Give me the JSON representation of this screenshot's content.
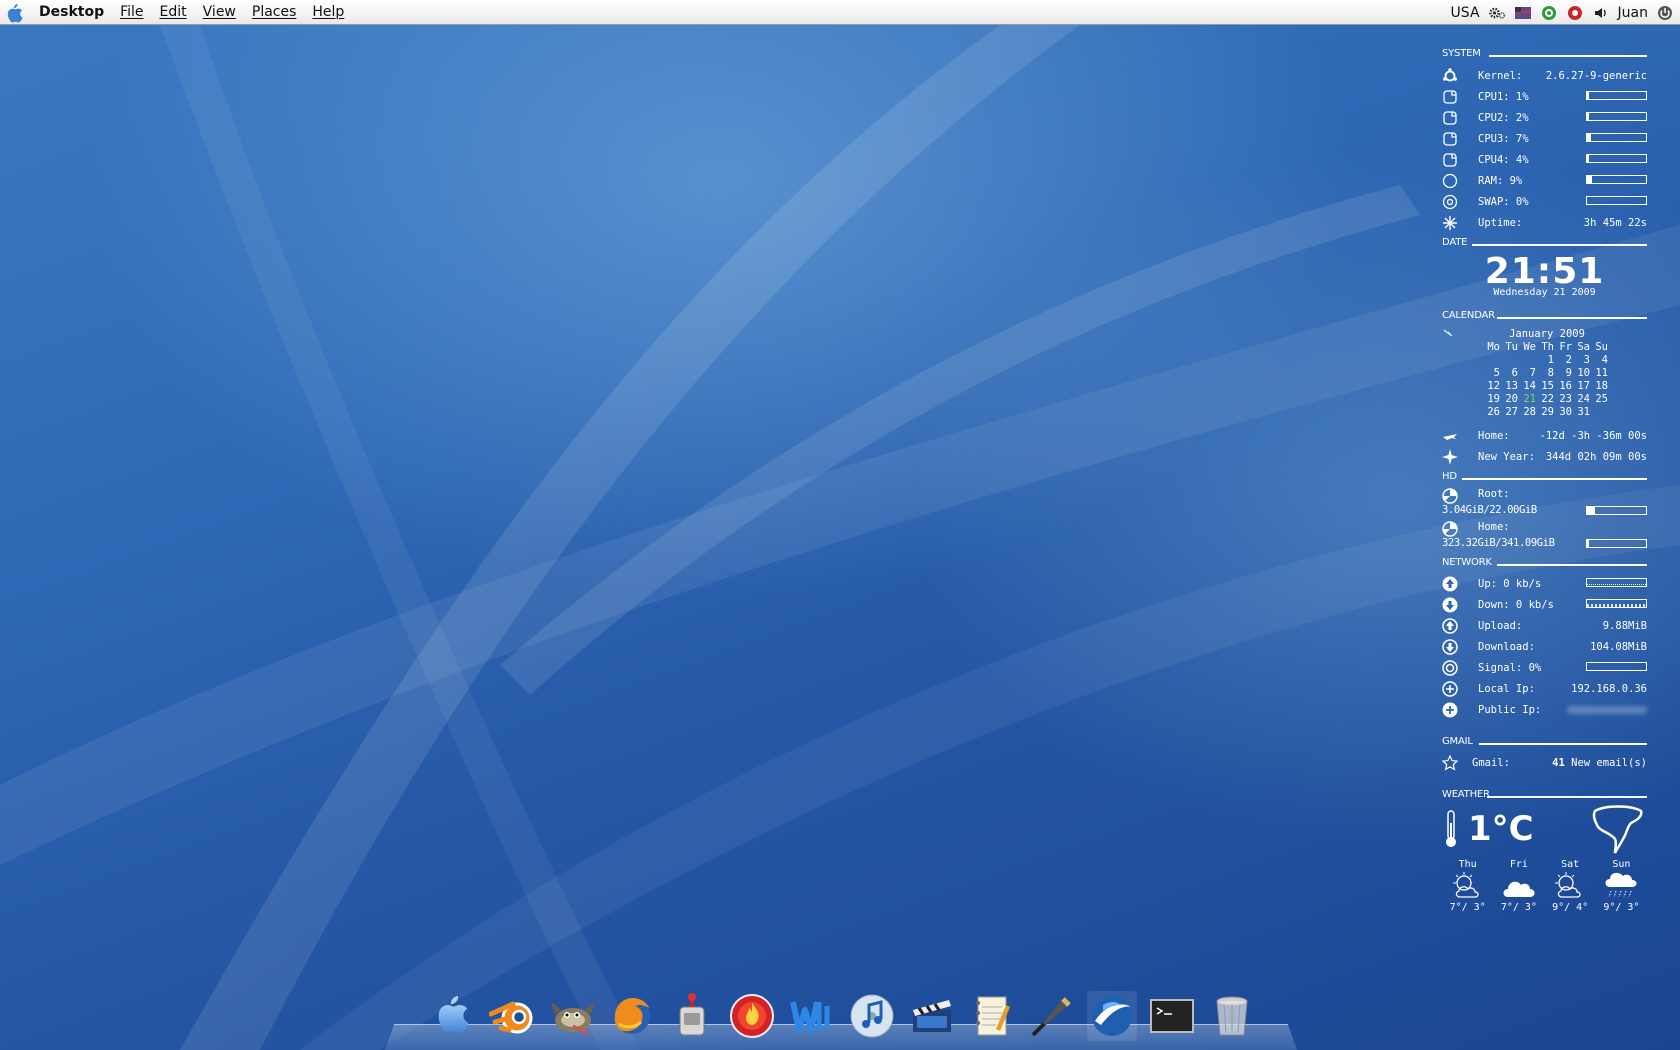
{
  "menubar": {
    "app_name": "Desktop",
    "menus": [
      "File",
      "Edit",
      "View",
      "Places",
      "Help"
    ],
    "keyboard_layout": "USA",
    "user": "Juan"
  },
  "conky": {
    "system": {
      "header": "SYSTEM",
      "kernel_label": "Kernel:",
      "kernel_value": "2.6.27-9-generic",
      "rows": [
        {
          "label": "CPU1: 1%",
          "level": 0.01
        },
        {
          "label": "CPU2: 2%",
          "level": 0.02
        },
        {
          "label": "CPU3: 7%",
          "level": 0.07
        },
        {
          "label": "CPU4: 4%",
          "level": 0.04
        },
        {
          "label": "RAM: 9%",
          "level": 0.09
        },
        {
          "label": "SWAP: 0%",
          "level": 0.0
        }
      ],
      "uptime_label": "Uptime:",
      "uptime_value": "3h 45m 22s"
    },
    "date": {
      "header": "DATE",
      "time": "21:51",
      "date": "Wednesday 21 2009"
    },
    "calendar": {
      "header": "CALENDAR",
      "month": "January  2009",
      "weekdays": [
        "Mo",
        "Tu",
        "We",
        "Th",
        "Fr",
        "Sa",
        "Su"
      ],
      "weeks": [
        [
          "",
          "",
          "",
          "1",
          "2",
          "3",
          "4"
        ],
        [
          "5",
          "6",
          "7",
          "8",
          "9",
          "10",
          "11"
        ],
        [
          "12",
          "13",
          "14",
          "15",
          "16",
          "17",
          "18"
        ],
        [
          "19",
          "20",
          "21",
          "22",
          "23",
          "24",
          "25"
        ],
        [
          "26",
          "27",
          "28",
          "29",
          "30",
          "31",
          ""
        ]
      ],
      "today": "21",
      "countdowns": [
        {
          "label": "Home:",
          "value": "-12d -3h -36m 00s"
        },
        {
          "label": "New Year:",
          "value": "344d 02h 09m 00s"
        }
      ]
    },
    "hd": {
      "header": "HD",
      "disks": [
        {
          "label": "Root:",
          "usage": "3.04GiB/22.00GiB",
          "level": 0.14
        },
        {
          "label": "Home:",
          "usage": "323.32GiB/341.09GiB",
          "level": 0.03
        }
      ]
    },
    "network": {
      "header": "NETWORK",
      "up_label": "Up: 0 kb/s",
      "down_label": "Down: 0 kb/s",
      "upload_label": "Upload:",
      "upload_value": "9.88MiB",
      "download_label": "Download:",
      "download_value": "104.08MiB",
      "signal_label": "Signal: 0%",
      "signal_level": 0.0,
      "local_ip_label": "Local Ip:",
      "local_ip_value": "192.168.0.36",
      "public_ip_label": "Public Ip:"
    },
    "gmail": {
      "header": "GMAIL",
      "label": "Gmail:",
      "count": "41",
      "suffix": "New email(s)"
    },
    "weather": {
      "header": "WEATHER",
      "temperature": "1°C",
      "forecast": [
        {
          "day": "Thu",
          "temps": "7°/ 3°",
          "icon": "partly-cloudy-icon"
        },
        {
          "day": "Fri",
          "temps": "7°/ 3°",
          "icon": "cloud-icon"
        },
        {
          "day": "Sat",
          "temps": "9°/ 4°",
          "icon": "partly-cloudy-icon"
        },
        {
          "day": "Sun",
          "temps": "9°/ 3°",
          "icon": "rain-icon"
        }
      ]
    }
  },
  "dock": {
    "items": [
      "finder",
      "blender",
      "gimp",
      "firefox",
      "synaptic",
      "firestarter",
      "writer",
      "itunes",
      "video-editor",
      "text-editor",
      "inkscape",
      "google-earth",
      "terminal",
      "trash"
    ]
  }
}
